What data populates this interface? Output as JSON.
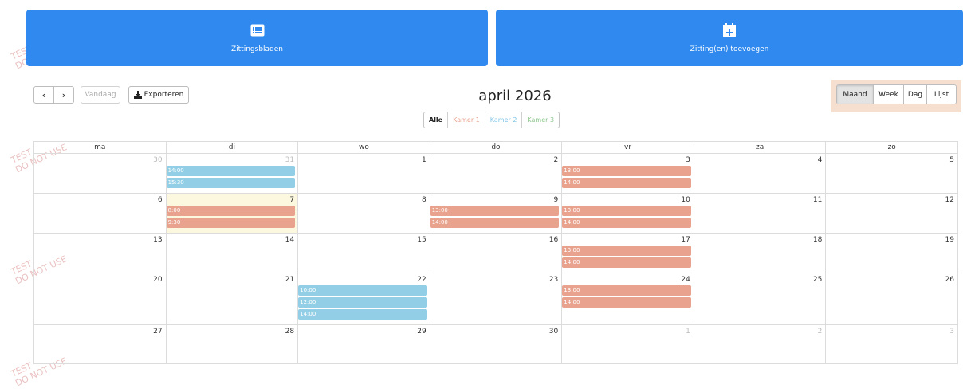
{
  "actions": {
    "sheets_label": "Zittingsbladen",
    "add_label": "Zitting(en) toevoegen",
    "sheets_icon": "list-icon",
    "add_icon": "calendar-plus-icon"
  },
  "toolbar": {
    "prev": "‹",
    "next": "›",
    "today": "Vandaag",
    "export": "Exporteren"
  },
  "title": "april 2026",
  "filters": [
    {
      "label": "Alle",
      "color": "#222222"
    },
    {
      "label": "Kamer 1",
      "color": "#e8a28d"
    },
    {
      "label": "Kamer 2",
      "color": "#7fc4e6"
    },
    {
      "label": "Kamer 3",
      "color": "#8cc58c"
    }
  ],
  "views": [
    "Maand",
    "Week",
    "Dag",
    "Lijst"
  ],
  "weekdays": [
    "ma",
    "di",
    "wo",
    "do",
    "vr",
    "za",
    "zo"
  ],
  "colors": {
    "kamer1": "#e8a28d",
    "kamer2": "#92cfe6",
    "accent": "#2f89ee",
    "today": "#fcf8e0"
  },
  "weeks": [
    [
      {
        "day": "30",
        "other": true,
        "events": []
      },
      {
        "day": "31",
        "other": true,
        "events": [
          {
            "time": "14:00",
            "color": "blue"
          },
          {
            "time": "15:30",
            "color": "blue"
          }
        ]
      },
      {
        "day": "1",
        "events": []
      },
      {
        "day": "2",
        "events": []
      },
      {
        "day": "3",
        "events": [
          {
            "time": "13:00",
            "color": "orange"
          },
          {
            "time": "14:00",
            "color": "orange"
          }
        ]
      },
      {
        "day": "4",
        "events": []
      },
      {
        "day": "5",
        "events": []
      }
    ],
    [
      {
        "day": "6",
        "events": []
      },
      {
        "day": "7",
        "today": true,
        "events": [
          {
            "time": "8:00",
            "color": "orange"
          },
          {
            "time": "9:30",
            "color": "orange"
          }
        ]
      },
      {
        "day": "8",
        "events": []
      },
      {
        "day": "9",
        "events": [
          {
            "time": "13:00",
            "color": "orange"
          },
          {
            "time": "14:00",
            "color": "orange"
          }
        ]
      },
      {
        "day": "10",
        "events": [
          {
            "time": "13:00",
            "color": "orange"
          },
          {
            "time": "14:00",
            "color": "orange"
          }
        ]
      },
      {
        "day": "11",
        "events": []
      },
      {
        "day": "12",
        "events": []
      }
    ],
    [
      {
        "day": "13",
        "events": []
      },
      {
        "day": "14",
        "events": []
      },
      {
        "day": "15",
        "events": []
      },
      {
        "day": "16",
        "events": []
      },
      {
        "day": "17",
        "events": [
          {
            "time": "13:00",
            "color": "orange"
          },
          {
            "time": "14:00",
            "color": "orange"
          }
        ]
      },
      {
        "day": "18",
        "events": []
      },
      {
        "day": "19",
        "events": []
      }
    ],
    [
      {
        "day": "20",
        "events": []
      },
      {
        "day": "21",
        "events": []
      },
      {
        "day": "22",
        "events": [
          {
            "time": "10:00",
            "color": "blue"
          },
          {
            "time": "12:00",
            "color": "blue"
          },
          {
            "time": "14:00",
            "color": "blue"
          }
        ]
      },
      {
        "day": "23",
        "events": []
      },
      {
        "day": "24",
        "events": [
          {
            "time": "13:00",
            "color": "orange"
          },
          {
            "time": "14:00",
            "color": "orange"
          }
        ]
      },
      {
        "day": "25",
        "events": []
      },
      {
        "day": "26",
        "events": []
      }
    ],
    [
      {
        "day": "27",
        "events": []
      },
      {
        "day": "28",
        "events": []
      },
      {
        "day": "29",
        "events": []
      },
      {
        "day": "30",
        "events": []
      },
      {
        "day": "1",
        "other": true,
        "events": []
      },
      {
        "day": "2",
        "other": true,
        "events": []
      },
      {
        "day": "3",
        "other": true,
        "events": []
      }
    ]
  ],
  "watermark": [
    "TEST",
    "DO NOT USE"
  ]
}
